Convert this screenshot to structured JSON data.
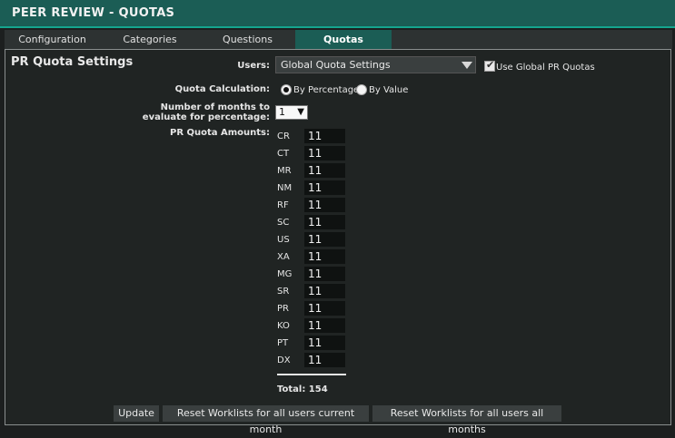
{
  "window": {
    "title": "PEER REVIEW - QUOTAS"
  },
  "tabs": [
    {
      "label": "Configuration",
      "active": false
    },
    {
      "label": "Categories",
      "active": false
    },
    {
      "label": "Questions",
      "active": false
    },
    {
      "label": "Quotas",
      "active": true
    }
  ],
  "section_title": "PR Quota Settings",
  "users": {
    "label": "Users:",
    "selected": "Global Quota Settings",
    "use_global_label": "Use Global PR Quotas",
    "use_global_checked": true
  },
  "quota_calc": {
    "label": "Quota Calculation:",
    "options": [
      {
        "label": "By Percentage",
        "selected": true
      },
      {
        "label": "By Value",
        "selected": false
      }
    ]
  },
  "months": {
    "label_line1": "Number of months to",
    "label_line2": "evaluate for percentage:",
    "selected": "1"
  },
  "amounts": {
    "label": "PR Quota Amounts:",
    "items": [
      {
        "code": "CR",
        "value": "11"
      },
      {
        "code": "CT",
        "value": "11"
      },
      {
        "code": "MR",
        "value": "11"
      },
      {
        "code": "NM",
        "value": "11"
      },
      {
        "code": "RF",
        "value": "11"
      },
      {
        "code": "SC",
        "value": "11"
      },
      {
        "code": "US",
        "value": "11"
      },
      {
        "code": "XA",
        "value": "11"
      },
      {
        "code": "MG",
        "value": "11"
      },
      {
        "code": "SR",
        "value": "11"
      },
      {
        "code": "PR",
        "value": "11"
      },
      {
        "code": "KO",
        "value": "11"
      },
      {
        "code": "PT",
        "value": "11"
      },
      {
        "code": "DX",
        "value": "11"
      }
    ],
    "total": "Total: 154"
  },
  "buttons": {
    "update": "Update",
    "reset_current": "Reset Worklists for all users current month",
    "reset_all": "Reset Worklists for all users all months"
  }
}
